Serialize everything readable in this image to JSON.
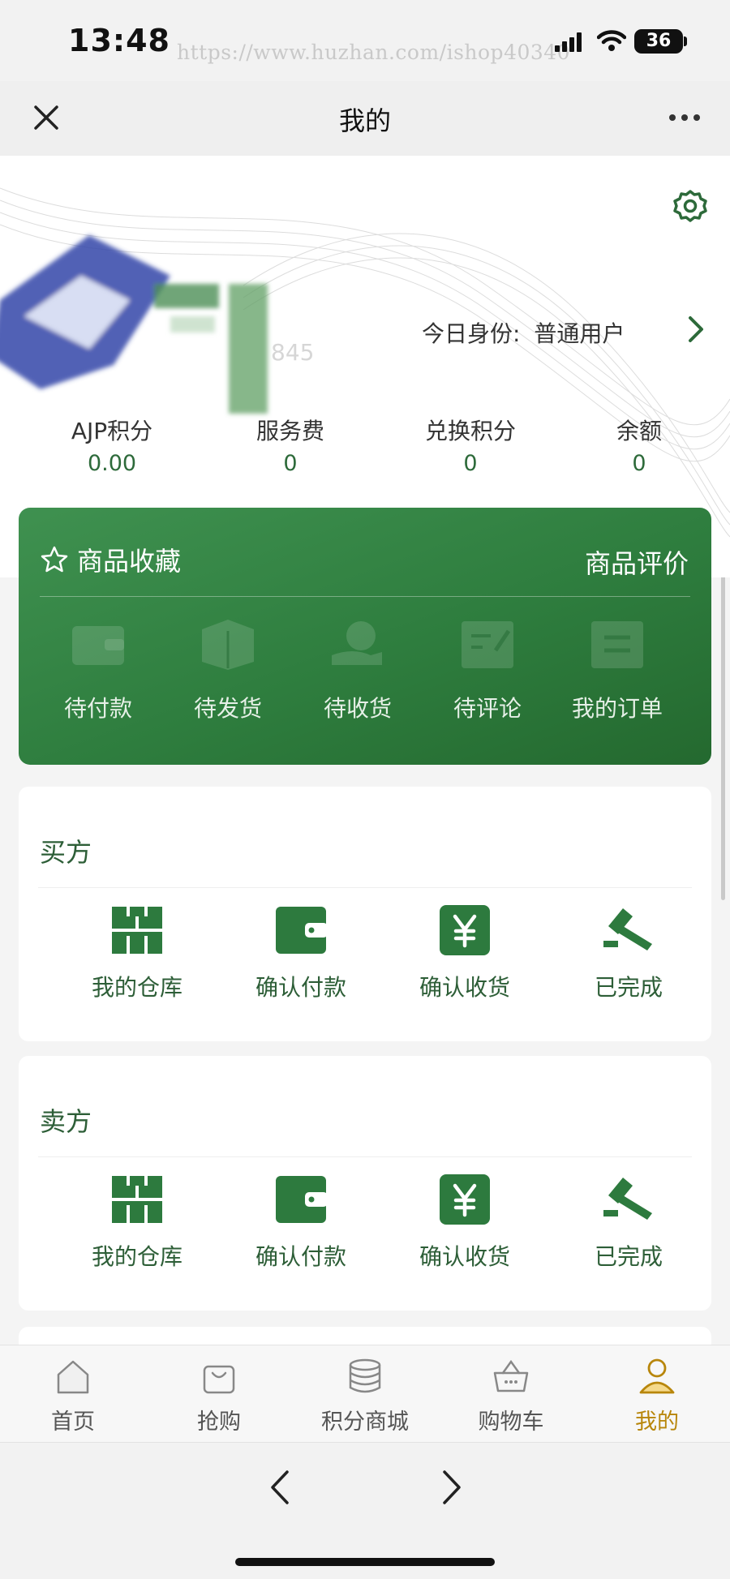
{
  "status_bar": {
    "time": "13:48",
    "watermark": "https://www.huzhan.com/ishop40340",
    "battery": "36"
  },
  "nav": {
    "title": "我的",
    "close_icon": "close-icon",
    "more_icon": "more-icon"
  },
  "profile": {
    "user_id_partial": "845",
    "identity_label": "今日身份:",
    "identity_value": "普通用户"
  },
  "stats": [
    {
      "label": "AJP积分",
      "value": "0.00"
    },
    {
      "label": "服务费",
      "value": "0"
    },
    {
      "label": "兑换积分",
      "value": "0"
    },
    {
      "label": "余额",
      "value": "0"
    }
  ],
  "order_card": {
    "favorites_label": "商品收藏",
    "review_label": "商品评价",
    "items": [
      {
        "label": "待付款",
        "icon": "wallet-icon"
      },
      {
        "label": "待发货",
        "icon": "box-icon"
      },
      {
        "label": "待收货",
        "icon": "delivery-icon"
      },
      {
        "label": "待评论",
        "icon": "comment-icon"
      },
      {
        "label": "我的订单",
        "icon": "order-list-icon"
      }
    ]
  },
  "buyer": {
    "title": "买方",
    "items": [
      {
        "label": "我的仓库",
        "icon": "warehouse-icon"
      },
      {
        "label": "确认付款",
        "icon": "wallet-icon"
      },
      {
        "label": "确认收货",
        "icon": "yen-icon"
      },
      {
        "label": "已完成",
        "icon": "gavel-icon"
      }
    ]
  },
  "seller": {
    "title": "卖方",
    "items": [
      {
        "label": "我的仓库",
        "icon": "warehouse-icon"
      },
      {
        "label": "确认付款",
        "icon": "wallet-icon"
      },
      {
        "label": "确认收货",
        "icon": "yen-icon"
      },
      {
        "label": "已完成",
        "icon": "gavel-icon"
      }
    ]
  },
  "tabbar": {
    "items": [
      {
        "label": "首页",
        "icon": "home-icon"
      },
      {
        "label": "抢购",
        "icon": "shopping-bag-icon"
      },
      {
        "label": "积分商城",
        "icon": "coins-icon"
      },
      {
        "label": "购物车",
        "icon": "cart-icon"
      },
      {
        "label": "我的",
        "icon": "user-icon"
      }
    ],
    "active_index": 4
  },
  "colors": {
    "primary_green": "#2e7d3e",
    "text_green": "#2d5e37",
    "active_tab": "#b8860b"
  }
}
